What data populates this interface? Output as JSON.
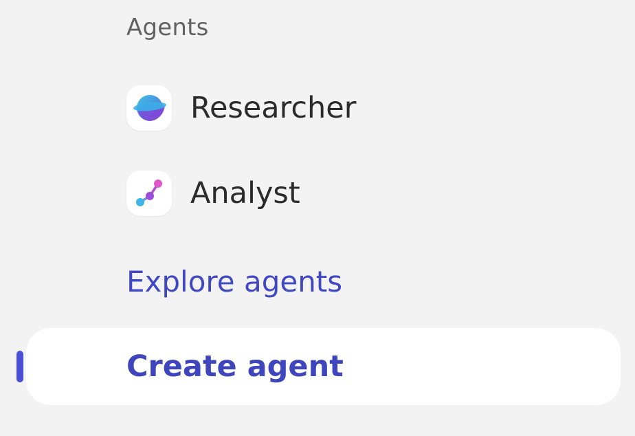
{
  "agents_section": {
    "header": "Agents",
    "items": [
      {
        "label": "Researcher",
        "icon": "researcher-planet-icon"
      },
      {
        "label": "Analyst",
        "icon": "analyst-graph-icon"
      }
    ],
    "explore_label": "Explore agents",
    "create_label": "Create agent"
  },
  "colors": {
    "background": "#f3f3f3",
    "link": "#4048c4",
    "selected_indicator": "#4a4fd6"
  }
}
